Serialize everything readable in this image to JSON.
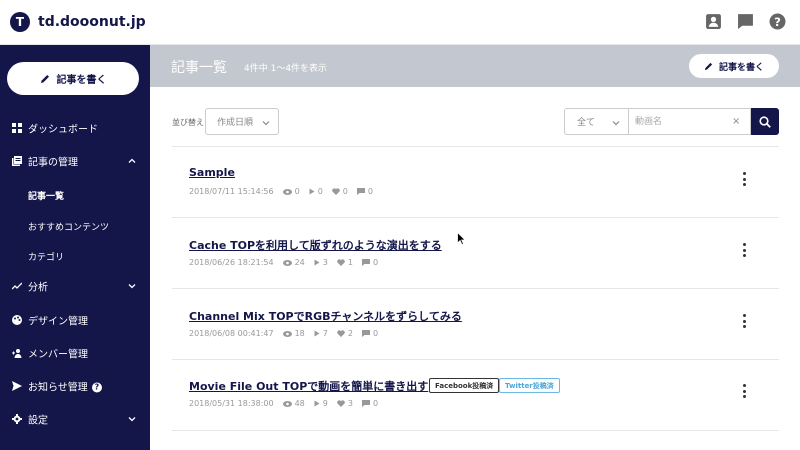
{
  "app": {
    "logo_letter": "T",
    "site_name": "td.dooonut.jp"
  },
  "topbar_icons": [
    "account-icon",
    "chat-icon",
    "help-icon"
  ],
  "sidebar": {
    "write_button": "記事を書く",
    "items": [
      {
        "label": "ダッシュボード",
        "icon": "grid-icon"
      },
      {
        "label": "記事の管理",
        "icon": "articles-icon",
        "expanded": true
      },
      {
        "label": "分析",
        "icon": "trend-icon"
      },
      {
        "label": "デザイン管理",
        "icon": "palette-icon"
      },
      {
        "label": "メンバー管理",
        "icon": "members-icon"
      },
      {
        "label": "お知らせ管理",
        "icon": "send-icon",
        "help": "?"
      },
      {
        "label": "設定",
        "icon": "gear-icon"
      }
    ],
    "subitems": [
      "記事一覧",
      "おすすめコンテンツ",
      "カテゴリ"
    ]
  },
  "header": {
    "title": "記事一覧",
    "count": "4件中 1〜4件を表示",
    "write_button": "記事を書く"
  },
  "toolbar": {
    "sort_label": "並び替え",
    "sort_value": "作成日順",
    "filter_value": "全て",
    "search_placeholder": "動画名",
    "clear": "×"
  },
  "articles": [
    {
      "title": "Sample",
      "date": "2018/07/11 15:14:56",
      "views": "0",
      "plays": "0",
      "likes": "0",
      "comments": "0",
      "badges": []
    },
    {
      "title": "Cache TOPを利用して版ずれのような演出をする",
      "date": "2018/06/26 18:21:54",
      "views": "24",
      "plays": "3",
      "likes": "1",
      "comments": "0",
      "badges": []
    },
    {
      "title": "Channel Mix TOPでRGBチャンネルをずらしてみる",
      "date": "2018/06/08 00:41:47",
      "views": "18",
      "plays": "7",
      "likes": "2",
      "comments": "0",
      "badges": []
    },
    {
      "title": "Movie File Out TOPで動画を簡単に書き出す",
      "date": "2018/05/31 18:38:00",
      "views": "48",
      "plays": "9",
      "likes": "3",
      "comments": "0",
      "badges": [
        "Facebook投稿済",
        "Twitter投稿済"
      ]
    }
  ],
  "colors": {
    "navy": "#14164a",
    "band": "#c3c7cf",
    "twitter": "#4ba6dc"
  }
}
